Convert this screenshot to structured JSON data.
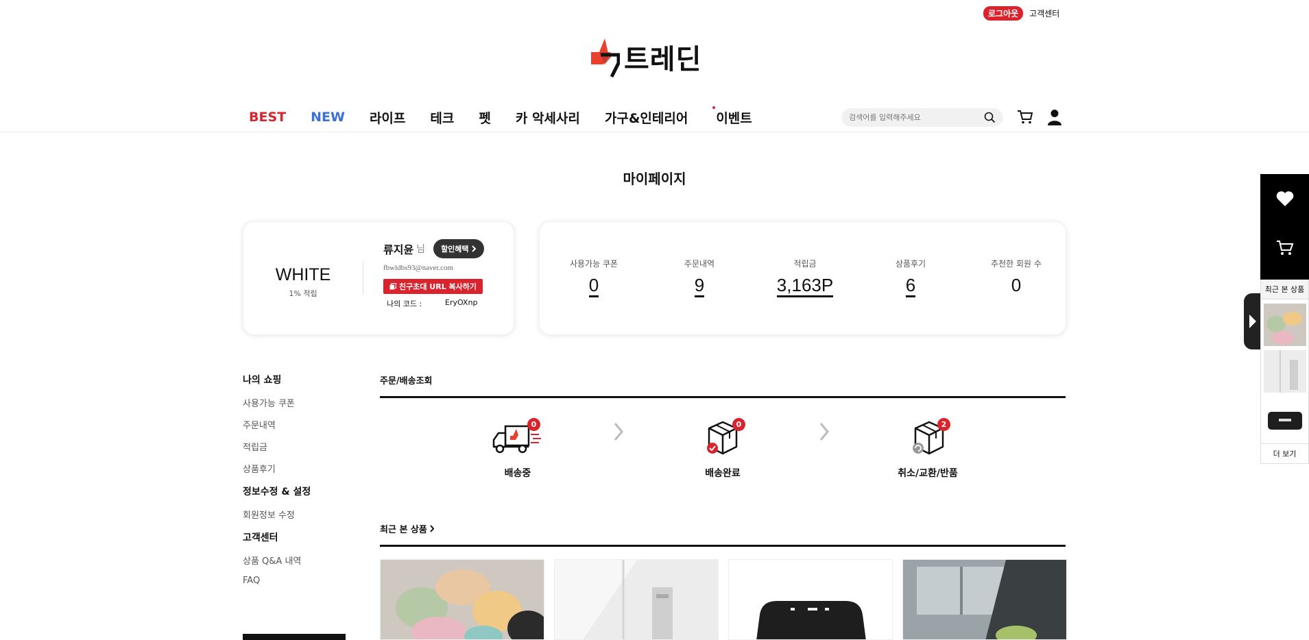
{
  "header": {
    "logout_label": "로그아웃",
    "cs_label": "고객센터",
    "logo_text": "트레딘",
    "nav": [
      "BEST",
      "NEW",
      "라이프",
      "테크",
      "펫",
      "카 악세사리",
      "가구&인테리어",
      "이벤트"
    ],
    "search_placeholder": "검색어를 입력해주세요"
  },
  "page": {
    "title": "마이페이지"
  },
  "profile": {
    "grade": "WHITE",
    "grade_rate": "1% 적립",
    "name": "류지윤",
    "name_suffix": "님",
    "benefit_label": "할인혜택",
    "email": "fbwldbs93@naver.com",
    "invite_label": "친구초대 URL 복사하기",
    "code_label": "나의 코드 :",
    "code_value": "EryOXnp"
  },
  "stats": [
    {
      "label": "사용가능 쿠폰",
      "value": "0"
    },
    {
      "label": "주문내역",
      "value": "9"
    },
    {
      "label": "적립금",
      "value": "3,163P"
    },
    {
      "label": "상품후기",
      "value": "6"
    },
    {
      "label": "추천한 회원 수",
      "value": "0"
    }
  ],
  "sidebar": {
    "groups": [
      {
        "title": "나의 쇼핑",
        "links": [
          "사용가능 쿠폰",
          "주문내역",
          "적립금",
          "상품후기"
        ]
      },
      {
        "title": "정보수정 & 설정",
        "links": [
          "회원정보 수정"
        ]
      },
      {
        "title": "고객센터",
        "links": [
          "상품 Q&A 내역",
          "FAQ"
        ]
      }
    ]
  },
  "orders": {
    "title": "주문/배송조회",
    "steps": [
      {
        "label": "배송중",
        "count": "0"
      },
      {
        "label": "배송완료",
        "count": "0"
      },
      {
        "label": "취소/교환/반품",
        "count": "2"
      }
    ]
  },
  "recent": {
    "title": "최근 본 상품"
  },
  "right_panel": {
    "recent_title": "최근 본 상품",
    "more_label": "더 보기"
  },
  "colors": {
    "accent": "#d9232d",
    "new_blue": "#3c6fd3",
    "dark": "#111111"
  }
}
